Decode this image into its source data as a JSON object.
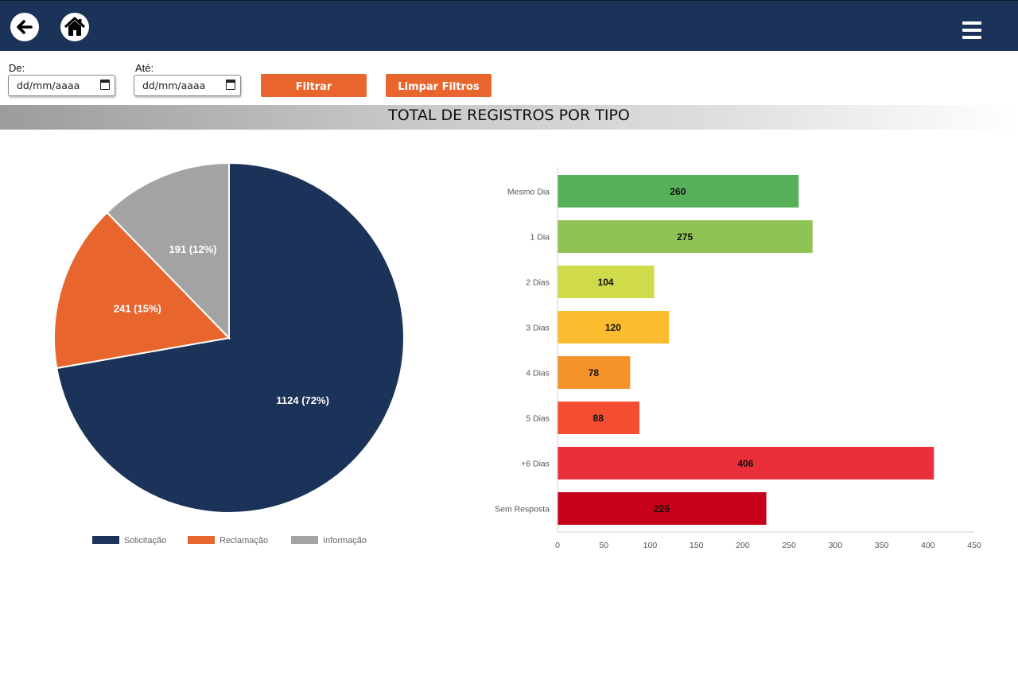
{
  "header": {
    "back_icon": "arrow-left-icon",
    "home_icon": "home-icon",
    "menu_icon": "hamburger-menu-icon",
    "background_color": "#1c3359"
  },
  "filters": {
    "from_label": "De:",
    "from_placeholder": "dd/mm/aaaa",
    "to_label": "Até:",
    "to_placeholder": "dd/mm/aaaa",
    "filter_button": "Filtrar",
    "clear_button": "Limpar Filtros",
    "button_color": "#e8662e"
  },
  "section": {
    "title": "TOTAL DE REGISTROS POR TIPO"
  },
  "chart_data": [
    {
      "type": "pie",
      "slices": [
        {
          "name": "Solicitação",
          "value": 1124,
          "percent": 72,
          "label": "1124 (72%)",
          "color": "#1c3359"
        },
        {
          "name": "Reclamação",
          "value": 241,
          "percent": 15,
          "label": "241 (15%)",
          "color": "#e8662e"
        },
        {
          "name": "Informação",
          "value": 191,
          "percent": 12,
          "label": "191 (12%)",
          "color": "#a3a3a3"
        }
      ],
      "legend": "bottom"
    },
    {
      "type": "bar",
      "orientation": "horizontal",
      "categories": [
        "Mesmo Dia",
        "1 Dia",
        "2 Dias",
        "3 Dias",
        "4 Dias",
        "5 Dias",
        "+6 Dias",
        "Sem Resposta"
      ],
      "values": [
        260,
        275,
        104,
        120,
        78,
        88,
        406,
        225
      ],
      "colors": [
        "#57b05a",
        "#8fc455",
        "#d0db4a",
        "#fbbc30",
        "#f5922a",
        "#f34e32",
        "#e9303a",
        "#c60019"
      ],
      "xlim": [
        0,
        450
      ],
      "xticks": [
        0,
        50,
        100,
        150,
        200,
        250,
        300,
        350,
        400,
        450
      ],
      "grid": false
    }
  ]
}
